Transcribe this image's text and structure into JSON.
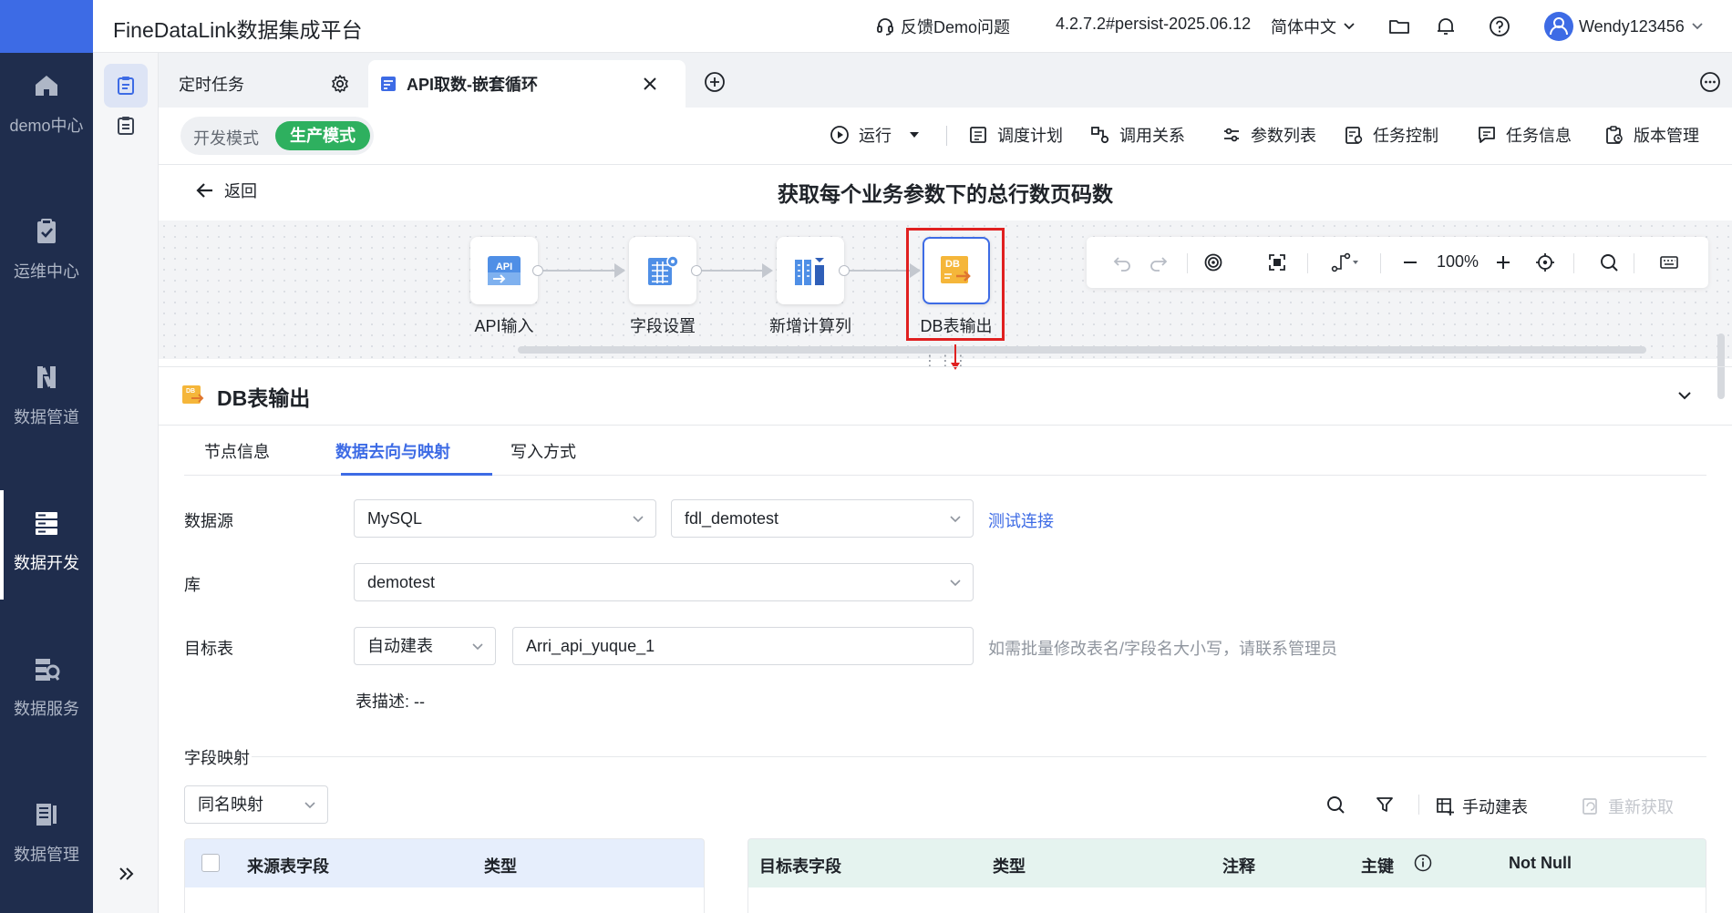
{
  "topbar": {
    "app_title": "FineDataLink数据集成平台",
    "feedback": "反馈Demo问题",
    "version": "4.2.7.2#persist-2025.06.12",
    "language": "简体中文",
    "username": "Wendy123456"
  },
  "leftnav": {
    "items": [
      {
        "label": "demo中心",
        "icon": "home-icon"
      },
      {
        "label": "运维中心",
        "icon": "clipboard-check-icon"
      },
      {
        "label": "数据管道",
        "icon": "pipeline-icon"
      },
      {
        "label": "数据开发",
        "icon": "server-stack-icon",
        "active": true
      },
      {
        "label": "数据服务",
        "icon": "data-service-icon"
      },
      {
        "label": "数据管理",
        "icon": "data-manage-icon"
      }
    ]
  },
  "tabs": [
    {
      "label": "定时任务"
    },
    {
      "label": "API取数-嵌套循环"
    }
  ],
  "mode": {
    "dev": "开发模式",
    "prod": "生产模式"
  },
  "toolbar": {
    "run": "运行",
    "schedule": "调度计划",
    "relations": "调用关系",
    "params": "参数列表",
    "task_control": "任务控制",
    "task_info": "任务信息",
    "version": "版本管理"
  },
  "back": "返回",
  "flow_title": "获取每个业务参数下的总行数页码数",
  "nodes": [
    {
      "label": "API输入",
      "icon_text": "API"
    },
    {
      "label": "字段设置"
    },
    {
      "label": "新增计算列"
    },
    {
      "label": "DB表输出",
      "icon_text": "DB"
    }
  ],
  "zoom": "100%",
  "panel": {
    "title": "DB表输出",
    "tabs": [
      "节点信息",
      "数据去向与映射",
      "写入方式"
    ],
    "active_tab": 1
  },
  "form": {
    "datasource_label": "数据源",
    "datasource_type": "MySQL",
    "datasource_conn": "fdl_demotest",
    "test_link": "测试连接",
    "db_label": "库",
    "db_value": "demotest",
    "target_label": "目标表",
    "target_mode": "自动建表",
    "target_table": "Arri_api_yuque_1",
    "target_hint": "如需批量修改表名/字段名大小写，请联系管理员",
    "table_desc": "表描述: --"
  },
  "mapping": {
    "section_label": "字段映射",
    "mode": "同名映射",
    "manual_create": "手动建表",
    "refetch": "重新获取",
    "src_headers": [
      "来源表字段",
      "类型"
    ],
    "tgt_headers": [
      "目标表字段",
      "类型",
      "注释",
      "主键",
      "Not Null"
    ]
  }
}
